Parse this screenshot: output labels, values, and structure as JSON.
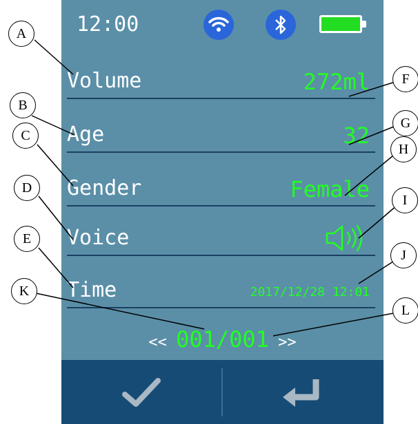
{
  "status_bar": {
    "time": "12:00",
    "wifi_icon": "wifi-icon",
    "bluetooth_icon": "bluetooth-icon",
    "battery_icon": "battery-icon"
  },
  "rows": [
    {
      "label": "Volume",
      "value": "272ml"
    },
    {
      "label": "Age",
      "value": "32"
    },
    {
      "label": "Gender",
      "value": "Female"
    },
    {
      "label": "Voice",
      "value_icon": "speaker-icon"
    },
    {
      "label": "Time",
      "value": "2017/12/28 12:01"
    }
  ],
  "pager": {
    "prev": "<<",
    "value": "001/001",
    "next": ">>"
  },
  "footer": {
    "confirm_icon": "checkmark-icon",
    "back_icon": "return-icon"
  },
  "callouts": {
    "A": "A",
    "B": "B",
    "C": "C",
    "D": "D",
    "E": "E",
    "F": "F",
    "G": "G",
    "H": "H",
    "I": "I",
    "J": "J",
    "K": "K",
    "L": "L"
  },
  "colors": {
    "screen_bg": "#5b8fa8",
    "value_green": "#22ff22",
    "footer_bg": "#164b75",
    "divider": "#1a3f63",
    "icon_blue": "#2a66d9"
  }
}
